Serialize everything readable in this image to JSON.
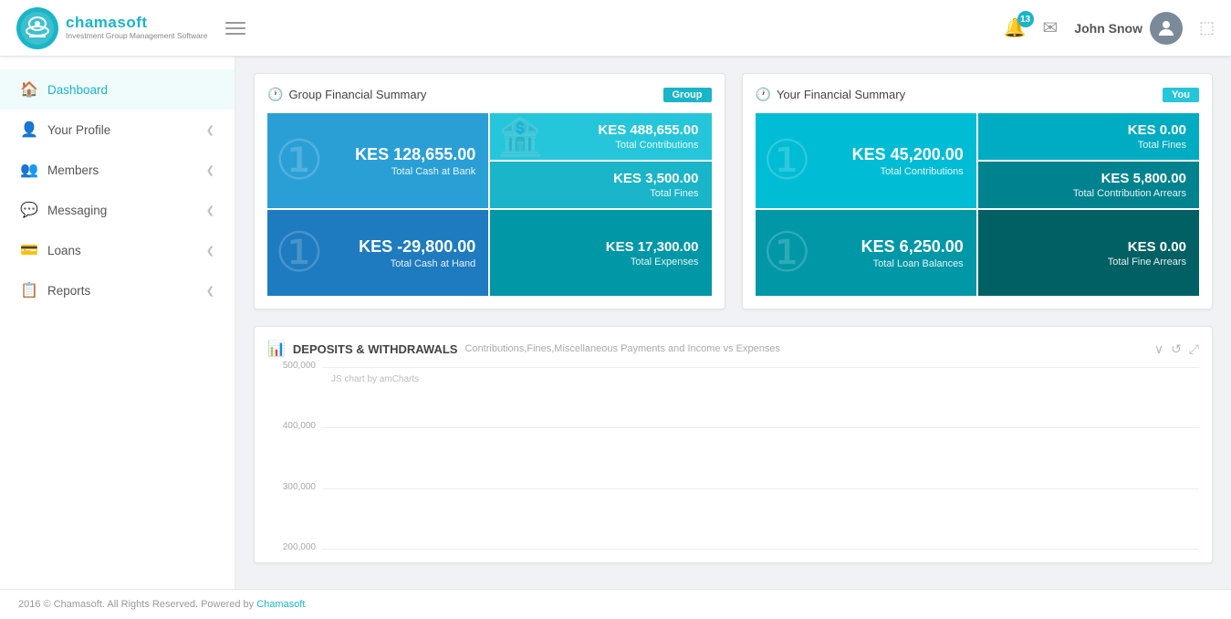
{
  "header": {
    "logo_name": "chamasoft",
    "logo_sub": "Investment Group Management Software",
    "bell_count": "13",
    "user_name": "John Snow"
  },
  "sidebar": {
    "items": [
      {
        "id": "dashboard",
        "label": "Dashboard",
        "icon": "🏠",
        "active": true
      },
      {
        "id": "your-profile",
        "label": "Your Profile",
        "icon": "👤",
        "has_chevron": true
      },
      {
        "id": "members",
        "label": "Members",
        "icon": "👥",
        "has_chevron": true
      },
      {
        "id": "messaging",
        "label": "Messaging",
        "icon": "💬",
        "has_chevron": true
      },
      {
        "id": "loans",
        "label": "Loans",
        "icon": "💳",
        "has_chevron": true
      },
      {
        "id": "reports",
        "label": "Reports",
        "icon": "📋",
        "has_chevron": true
      }
    ]
  },
  "group_summary": {
    "title": "Group Financial Summary",
    "tag": "Group",
    "cells": [
      {
        "amount": "KES 128,655.00",
        "label": "Total Cash at Bank",
        "color": "group-tl"
      },
      {
        "amount": "KES 488,655.00",
        "label": "Total Contributions",
        "color": "group-tr"
      },
      {
        "amount": "KES -29,800.00",
        "label": "Total Cash at Hand",
        "color": "group-bl"
      },
      {
        "amount": "KES 3,500.00",
        "label": "Total Fines",
        "color": "group-tr"
      },
      {
        "amount": "KES 17,300.00",
        "label": "Total Expenses",
        "color": "group-br"
      }
    ]
  },
  "your_summary": {
    "title": "Your Financial Summary",
    "tag": "You",
    "cells": [
      {
        "amount": "KES 45,200.00",
        "label": "Total Contributions",
        "color": "your-tl"
      },
      {
        "amount": "KES 0.00",
        "label": "Total Fines",
        "color": "your-tr"
      },
      {
        "amount": "KES 6,250.00",
        "label": "Total Loan Balances",
        "color": "your-bl"
      },
      {
        "amount": "KES 5,800.00",
        "label": "Total Contribution Arrears",
        "color": "your-tr"
      },
      {
        "amount": "KES 0.00",
        "label": "Total Fine Arrears",
        "color": "your-br"
      }
    ]
  },
  "chart": {
    "title": "DEPOSITS & WITHDRAWALS",
    "subtitle": "Contributions,Fines,Miscellaneous Payments and Income vs Expenses",
    "note": "JS chart by amCharts",
    "y_labels": [
      "500,000",
      "400,000",
      "300,000",
      "200,000"
    ],
    "bar_height_pct": 85
  },
  "footer": {
    "text": "2016 © Chamasoft. All Rights Reserved. Powered by ",
    "link_text": "Chamasoft"
  }
}
